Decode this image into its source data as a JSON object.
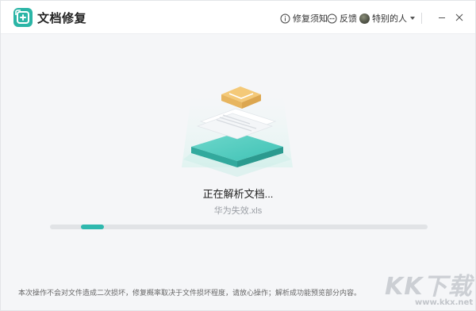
{
  "app": {
    "title": "文档修复",
    "colors": {
      "accent": "#2fb8ae",
      "brand": "#2bb5a6"
    }
  },
  "toolbar": {
    "help_label": "修复须知",
    "feedback_label": "反馈",
    "user_name": "特别的人",
    "icons": [
      "info-icon",
      "chat-icon",
      "avatar",
      "chevron-down-icon",
      "minimize-icon",
      "close-icon"
    ]
  },
  "main": {
    "status": "正在解析文档...",
    "file_name": "华为失效.xls",
    "progress": 0.14
  },
  "footer": {
    "notice": "本次操作不会对文件造成二次损坏，修复概率取决于文件损坏程度，请放心操作；解析成功能预览部分内容。"
  },
  "watermark": {
    "brand": "KK下载",
    "url": "www.kkx.net"
  }
}
